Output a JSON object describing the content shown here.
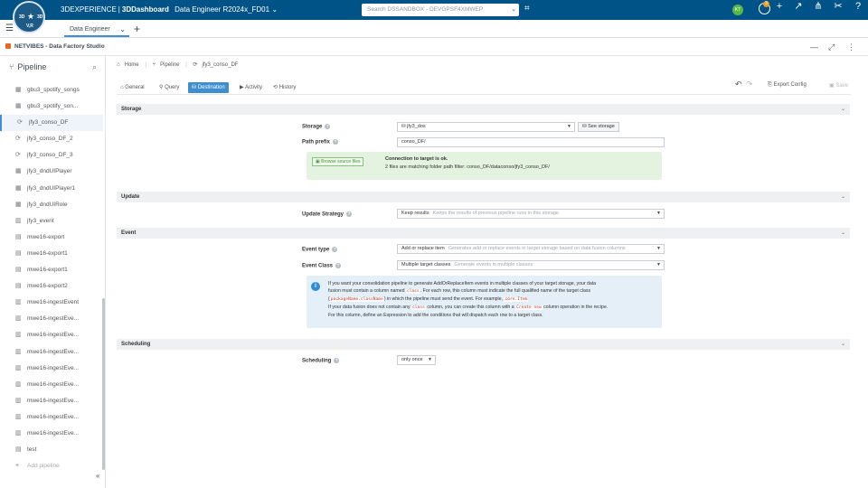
{
  "topbar": {
    "logo": {
      "l1": "3D",
      "l2": "★",
      "l3": "3D",
      "l4": "V,R"
    },
    "brand_prefix": "3DEXPERIENCE",
    "brand_sep": "|",
    "brand_app": "3DDashboard",
    "context": "Data Engineer R2024x_FD01",
    "search_placeholder": "Search DSSANDBOX - DEVGPSF4XMWEP",
    "avatar": "KT",
    "notif_count": "3"
  },
  "tabbar": {
    "tab_label": "Data Engineer"
  },
  "appbar": {
    "title": "NETVIBES - Data Factory Studio"
  },
  "sidebar": {
    "title": "Pipeline",
    "items": [
      {
        "label": "gbu3_spotify_songs",
        "icon": "▦"
      },
      {
        "label": "gbu3_spotify_son...",
        "icon": "▦"
      },
      {
        "label": "jfy3_conso_DF",
        "icon": "⟳"
      },
      {
        "label": "jfy3_conso_DF_2",
        "icon": "⟳"
      },
      {
        "label": "jfy3_conso_DF_3",
        "icon": "⟳"
      },
      {
        "label": "jfy3_dndUIPlayer",
        "icon": "▦"
      },
      {
        "label": "jfy3_dndUIPlayer1",
        "icon": "▦"
      },
      {
        "label": "jfy3_dndUIRole",
        "icon": "▦"
      },
      {
        "label": "jfy3_event",
        "icon": "▥"
      },
      {
        "label": "mwe16-export",
        "icon": "▤"
      },
      {
        "label": "mwe16-export1",
        "icon": "▤"
      },
      {
        "label": "mwe16-export1",
        "icon": "▤"
      },
      {
        "label": "mwe16-export2",
        "icon": "▤"
      },
      {
        "label": "mwe16-ingestEvent",
        "icon": "▥"
      },
      {
        "label": "mwe16-ingestEve...",
        "icon": "▥"
      },
      {
        "label": "mwe16-ingestEve...",
        "icon": "▥"
      },
      {
        "label": "mwe16-ingestEve...",
        "icon": "▥"
      },
      {
        "label": "mwe16-ingestEve...",
        "icon": "▥"
      },
      {
        "label": "mwe16-ingestEve...",
        "icon": "▥"
      },
      {
        "label": "mwe16-ingestEve...",
        "icon": "▥"
      },
      {
        "label": "mwe16-ingestEve...",
        "icon": "▥"
      },
      {
        "label": "mwe16-ingestEve...",
        "icon": "▥"
      },
      {
        "label": "test",
        "icon": "▤"
      },
      {
        "label": "Add pipeline",
        "icon": "+"
      }
    ],
    "collapse": "«"
  },
  "breadcrumb": {
    "home": "Home",
    "pipeline": "Pipeline",
    "current": "jfy3_conso_DF"
  },
  "subtabs": {
    "general": "General",
    "query": "Query",
    "destination": "Destination",
    "activity": "Activity",
    "history": "History"
  },
  "toolbar": {
    "export": "Export Config",
    "save": "Save"
  },
  "storage": {
    "section": "Storage",
    "storage_label": "Storage",
    "storage_value": "jfy3_dos",
    "see_storage": "See storage",
    "path_label": "Path prefix",
    "path_value": "conso_DF/",
    "browse": "Browse source files",
    "ok_title": "Connection to target is ok.",
    "ok_detail": "2 files are matching folder path filter: conso_DF/dataconso/jfy3_conso_DF/"
  },
  "update": {
    "section": "Update",
    "label": "Update Strategy",
    "value": "Keep results",
    "hint": "Keeps the results of previous pipeline runs in this storage"
  },
  "event": {
    "section": "Event",
    "type_label": "Event type",
    "type_value": "Add or replace item",
    "type_hint": "Generates add or replace events in target storage based on data fusion columns",
    "class_label": "Event Class",
    "class_value": "Multiple target classes",
    "class_hint": "Generate events in multiple classes",
    "info": {
      "t1": "If you want your consolidation pipeline to generate AddOrReplaceItem events in multiple classes of your target storage, your data",
      "t2": "fusion must contain a column named",
      "c1": "class",
      "t3": ". For each row, this column must indicate the full qualified name of the target class",
      "t4": "(",
      "c2": "packageName.className",
      "t5": ") in which the pipeline must send the event. For example,",
      "c3": "core.Item",
      "t6": "If your data fusion does not contain any",
      "c4": "class",
      "t7": "column, you can create this column with a",
      "c5": "Create new",
      "t8": "column operation in the recipe.",
      "t9": "For this column, define an Expression to add the conditions that will dispatch each row to a target class."
    }
  },
  "scheduling": {
    "section": "Scheduling",
    "label": "Scheduling",
    "value": "only once"
  }
}
